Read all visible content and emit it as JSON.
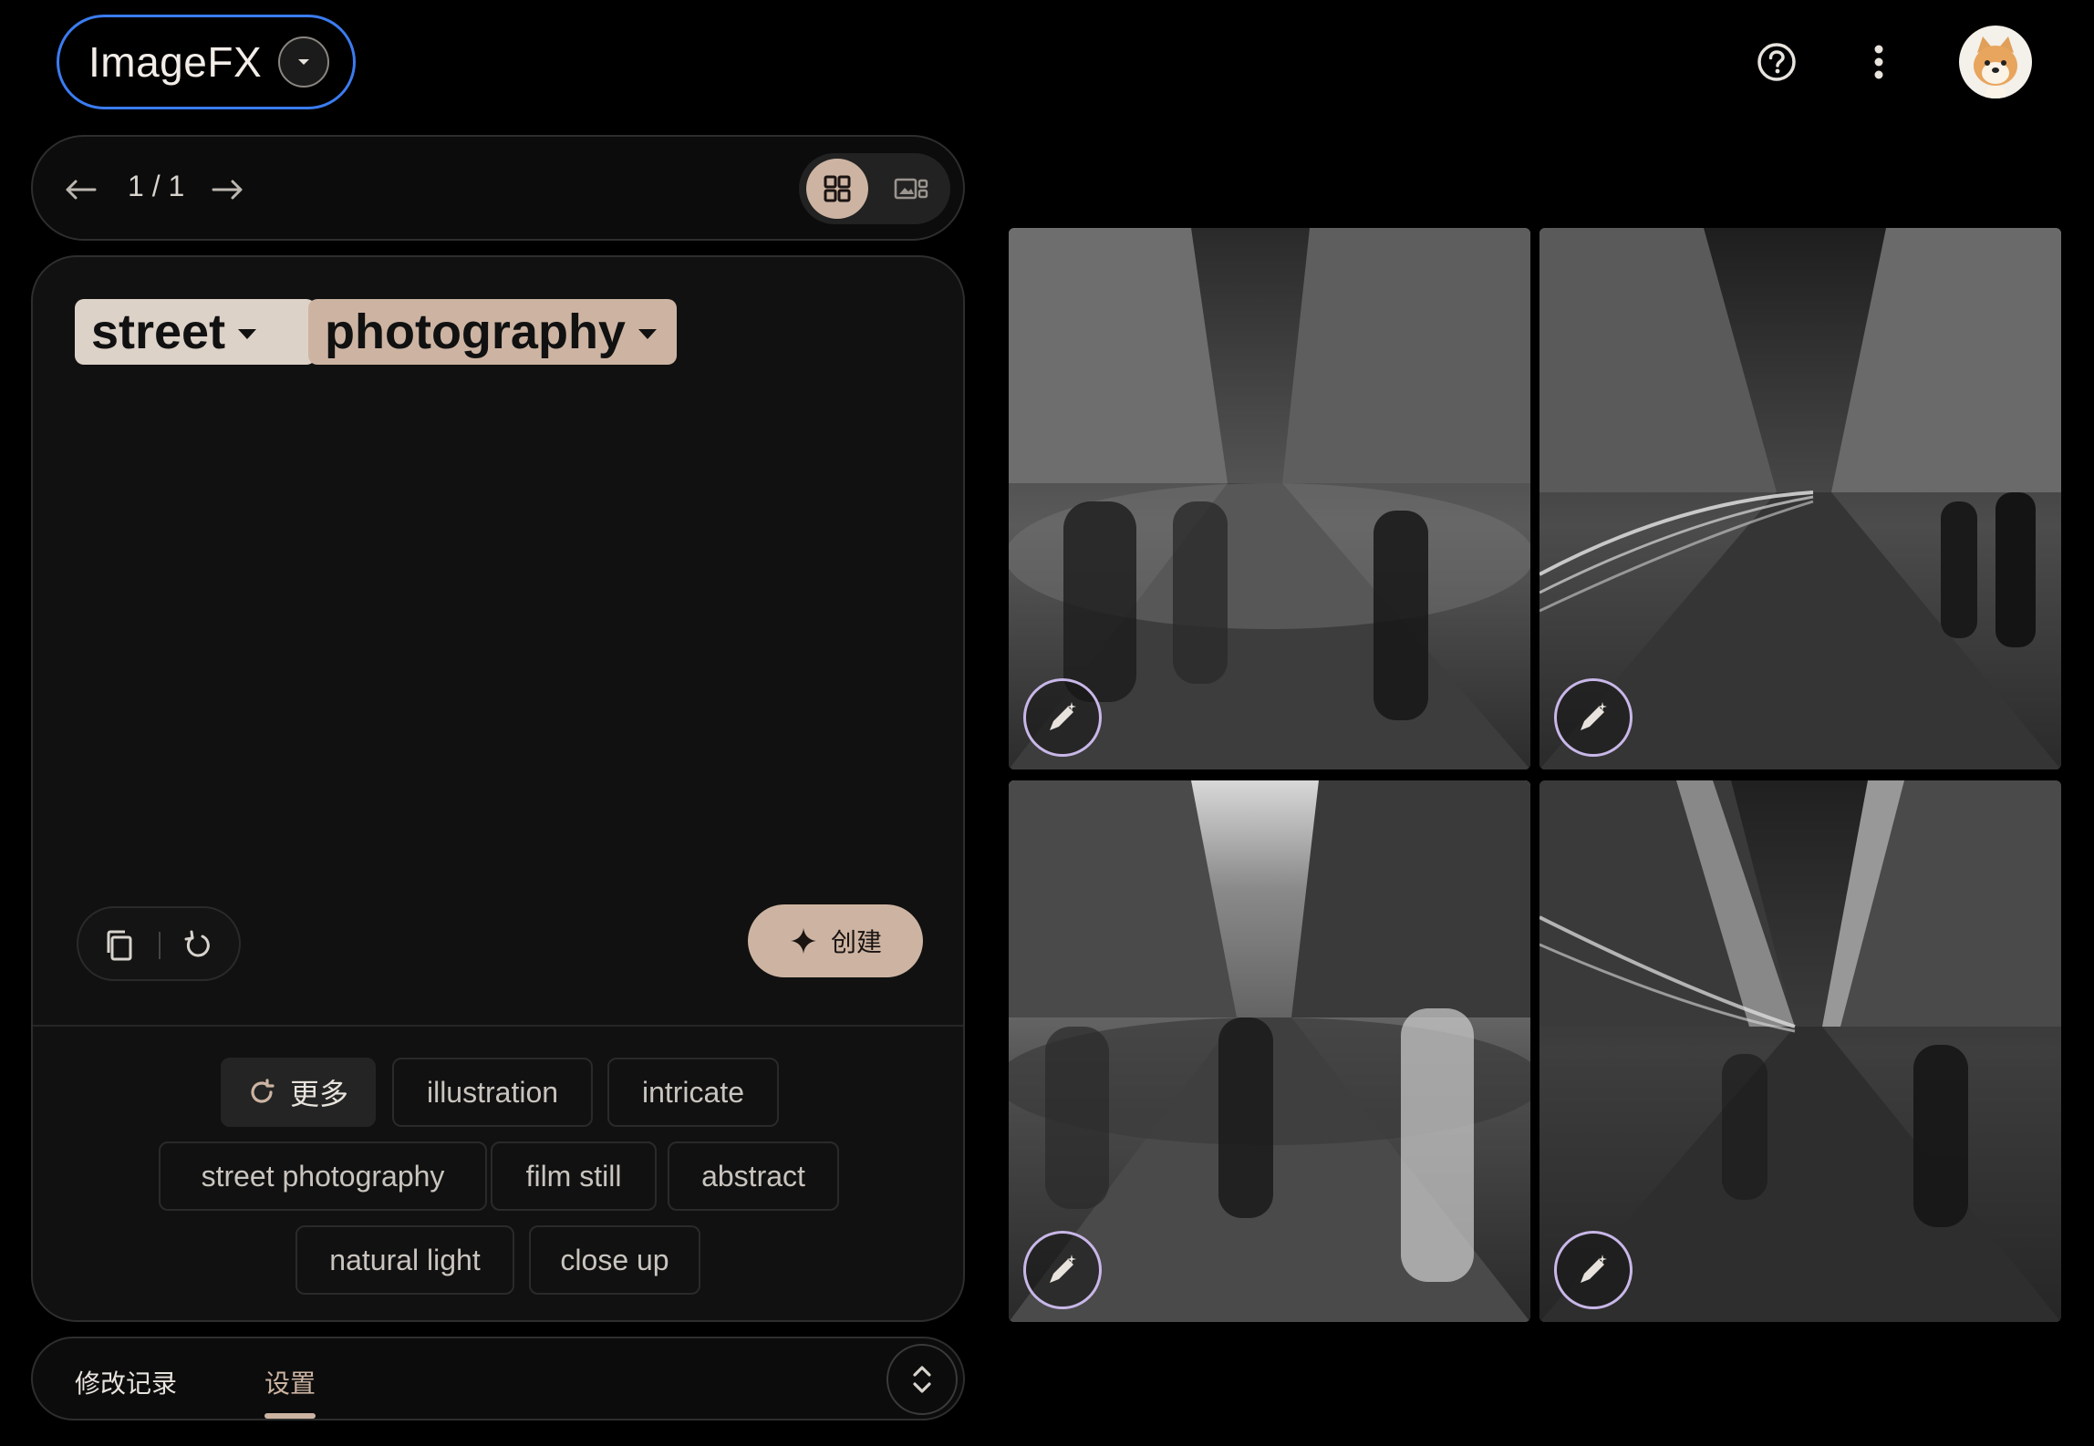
{
  "header": {
    "app_name": "ImageFX"
  },
  "pager": {
    "page_indicator": "1 / 1"
  },
  "prompt": {
    "chips": [
      {
        "label": "street"
      },
      {
        "label": "photography"
      }
    ],
    "create_label": "创建"
  },
  "suggestions": {
    "more_label": "更多",
    "items": [
      {
        "label": "illustration"
      },
      {
        "label": "intricate"
      },
      {
        "label": "street photography"
      },
      {
        "label": "film still"
      },
      {
        "label": "abstract"
      },
      {
        "label": "natural light"
      },
      {
        "label": "close up"
      }
    ]
  },
  "tabs": {
    "history_label": "修改记录",
    "settings_label": "设置"
  },
  "images": [
    {
      "name": "generated-image-1"
    },
    {
      "name": "generated-image-2"
    },
    {
      "name": "generated-image-3"
    },
    {
      "name": "generated-image-4"
    }
  ],
  "colors": {
    "accent": "#cdb4a2",
    "chip_light": "#ddd2c8",
    "focus_ring": "#3b7cf0",
    "background": "#000000",
    "card": "#111111"
  },
  "icons": {
    "logo_dropdown": "chevron-down-icon",
    "help": "help-circle-icon",
    "more": "more-vert-icon",
    "prev": "arrow-left-icon",
    "next": "arrow-right-icon",
    "grid_view": "grid-view-icon",
    "single_view": "single-view-icon",
    "copy": "copy-icon",
    "reset": "reset-icon",
    "sparkle": "sparkle-icon",
    "refresh": "refresh-icon",
    "expand": "unfold-icon",
    "edit": "edit-pen-icon"
  }
}
